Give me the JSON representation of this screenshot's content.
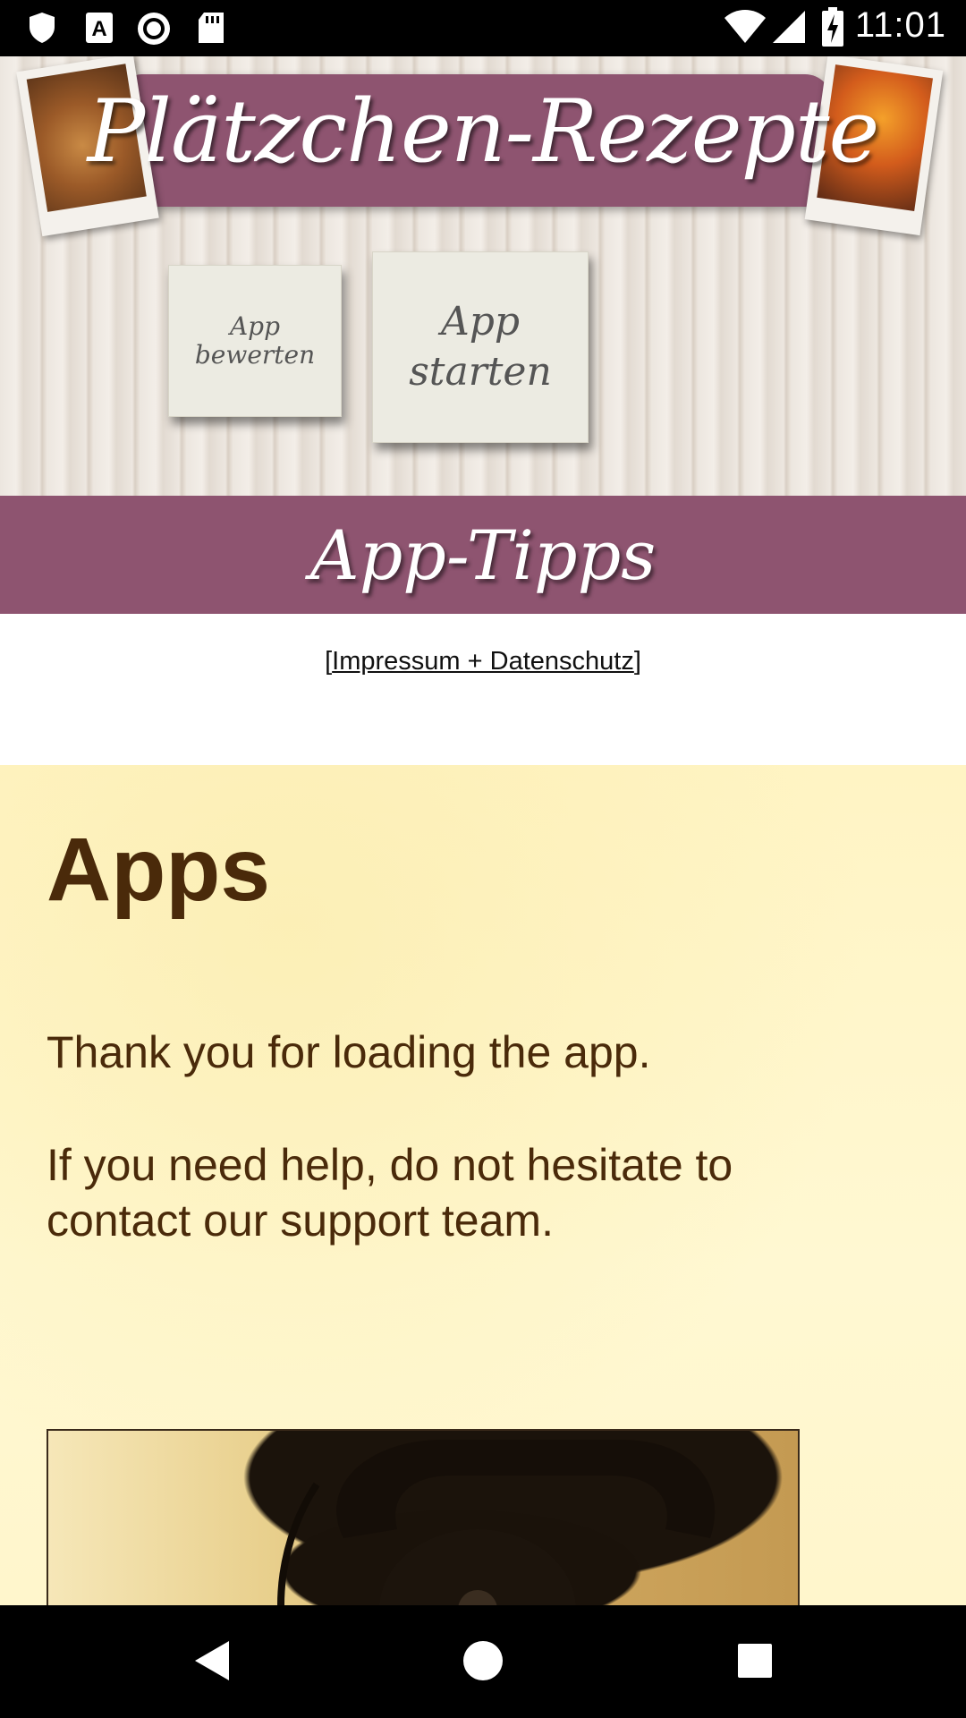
{
  "status_bar": {
    "time": "11:01",
    "icons": [
      "shield-icon",
      "font-a-icon",
      "record-icon",
      "sd-card-icon",
      "wifi-icon",
      "signal-icon",
      "battery-charging-icon"
    ]
  },
  "header": {
    "title": "Plätzchen-Rezepte",
    "rate_button": "App\nbewerten",
    "start_button": "App\nstarten"
  },
  "tipps": {
    "title": "App-Tipps"
  },
  "impressum": {
    "open_bracket": "[",
    "link": "Impressum + Datenschutz",
    "close_bracket": "]"
  },
  "apps": {
    "heading": "Apps",
    "text1": "Thank you for loading the app.",
    "text2": "If you need help, do not hesitate to contact our support team."
  },
  "navbar": {
    "icons": [
      "back-icon",
      "home-icon",
      "recents-icon"
    ]
  },
  "colors": {
    "accent": "#8e5470",
    "text_brown": "#4a2a0a",
    "section_bg": "#fff4c4"
  }
}
